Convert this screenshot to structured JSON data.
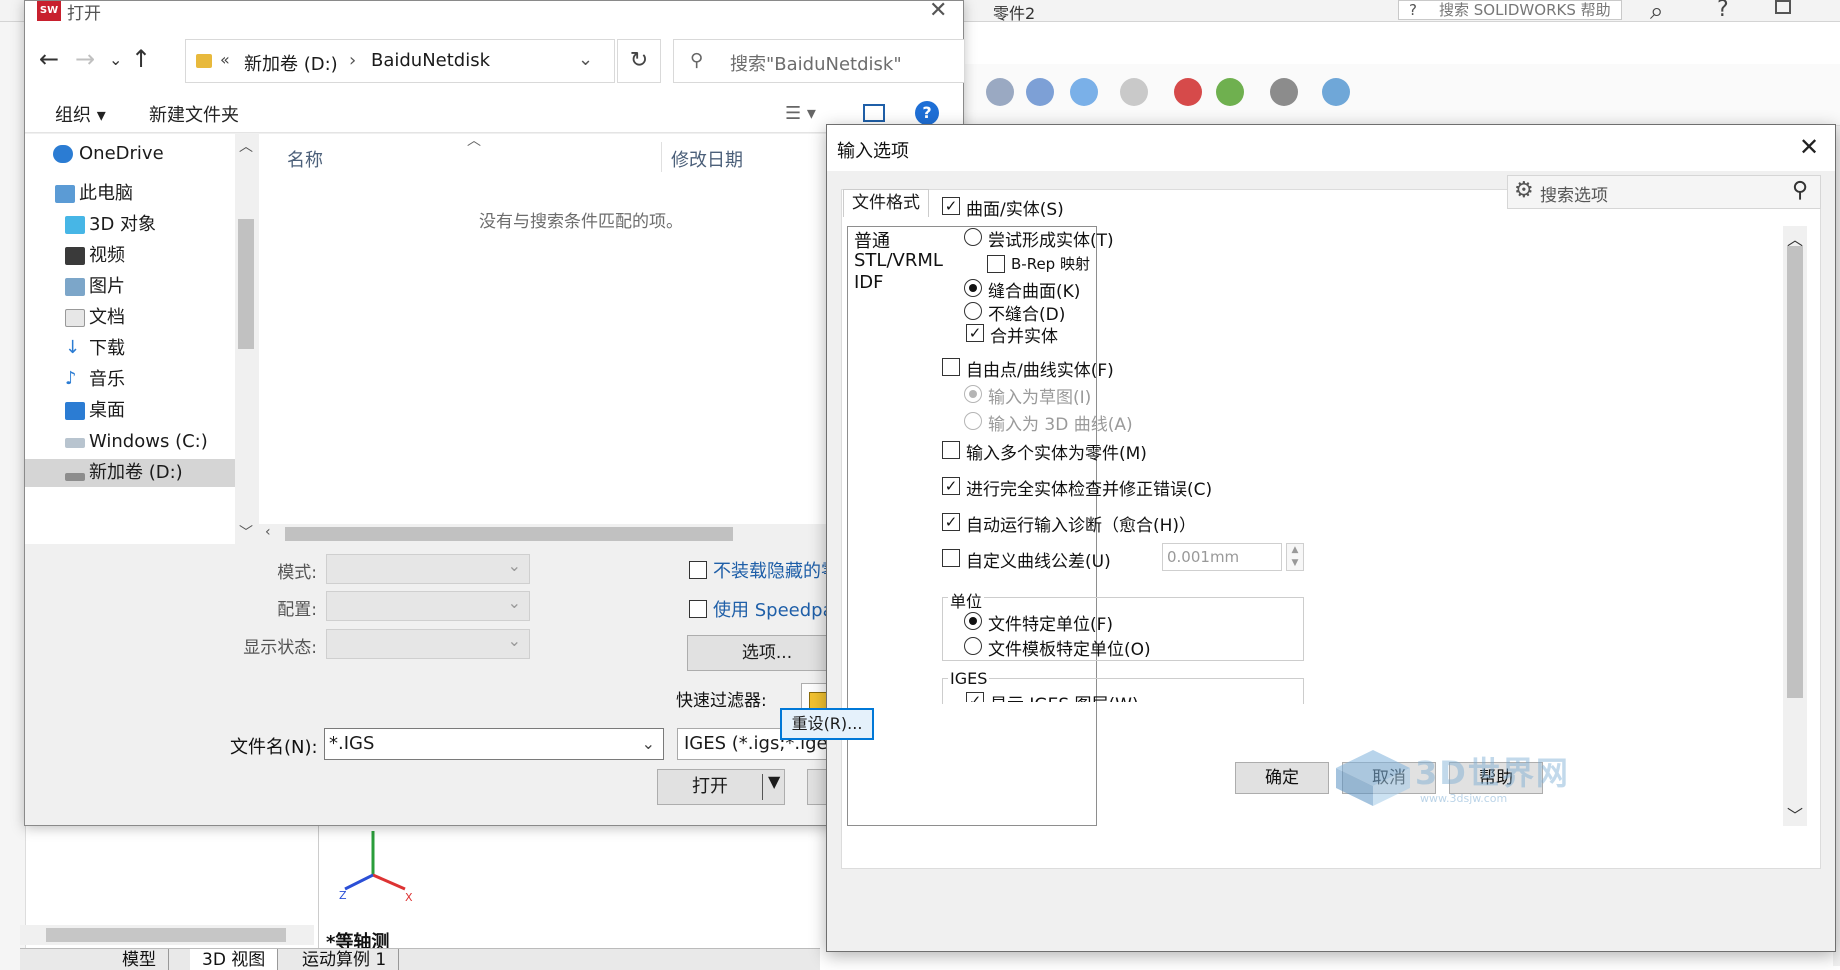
{
  "solidworks": {
    "document_title": "零件2",
    "help_search_placeholder": "搜索 SOLIDWORKS 帮助",
    "view_label": "*等轴测",
    "tabs": [
      "模型",
      "3D 视图",
      "运动算例 1"
    ]
  },
  "open_dialog": {
    "title": "打开",
    "app_icon_text": "SW",
    "address": {
      "chevrons": "«",
      "path": [
        "新加卷 (D:)",
        "BaiduNetdisk"
      ],
      "separator": "›"
    },
    "search_placeholder": "搜索\"BaiduNetdisk\"",
    "commands": {
      "organize": "组织 ▾",
      "new_folder": "新建文件夹"
    },
    "nav_items": [
      {
        "label": "OneDrive",
        "icon": "cloud-icon"
      },
      {
        "label": "此电脑",
        "icon": "computer-icon"
      },
      {
        "label": "3D 对象",
        "icon": "3d-objects-icon"
      },
      {
        "label": "视频",
        "icon": "video-icon"
      },
      {
        "label": "图片",
        "icon": "pictures-icon"
      },
      {
        "label": "文档",
        "icon": "documents-icon"
      },
      {
        "label": "下载",
        "icon": "download-icon"
      },
      {
        "label": "音乐",
        "icon": "music-icon"
      },
      {
        "label": "桌面",
        "icon": "desktop-icon"
      },
      {
        "label": "Windows (C:)",
        "icon": "drive-c-icon"
      },
      {
        "label": "新加卷 (D:)",
        "icon": "drive-d-icon"
      }
    ],
    "columns": {
      "name": "名称",
      "modified": "修改日期"
    },
    "empty_message": "没有与搜索条件匹配的项。",
    "form": {
      "mode_label": "模式:",
      "config_label": "配置:",
      "display_state_label": "显示状态:",
      "hide_components_label": "不装载隐藏的零部件",
      "speedpak_label": "使用 Speedpak(U)",
      "options_button": "选项...",
      "quick_filter_label": "快速过滤器:",
      "filename_label": "文件名(N):",
      "filename_value": "*.IGS",
      "filter_value": "IGES (*.igs;*.iges)",
      "open_button": "打开"
    }
  },
  "import_dialog": {
    "title": "输入选项",
    "tab_label": "文件格式",
    "search_placeholder": "搜索选项",
    "formats": [
      "普通",
      "STL/VRML",
      "IDF"
    ],
    "options": {
      "surfaces_solids": "曲面/实体(S)",
      "try_form_solid": "尝试形成实体(T)",
      "brep_mapping": "B-Rep 映射",
      "knit_surfaces": "缝合曲面(K)",
      "no_knit": "不缝合(D)",
      "merge_entities": "合并实体",
      "free_point_curve": "自由点/曲线实体(F)",
      "import_as_sketch": "输入为草图(I)",
      "import_as_3d_curve": "输入为 3D 曲线(A)",
      "import_multiple_bodies": "输入多个实体为零件(M)",
      "full_entity_check": "进行完全实体检查并修正错误(C)",
      "auto_import_diagnostics": "自动运行输入诊断（愈合(H)）",
      "custom_curve_tolerance": "自定义曲线公差(U)",
      "tolerance_value": "0.001mm"
    },
    "units_group": {
      "title": "单位",
      "file_units": "文件特定单位(F)",
      "template_units": "文件模板特定单位(O)"
    },
    "iges_group": {
      "title": "IGES",
      "show_layers": "显示 IGES 图层(W)"
    },
    "buttons": {
      "reset": "重设(R)...",
      "ok": "确定",
      "cancel": "取消",
      "help": "帮助"
    }
  },
  "watermark": {
    "text": "3D世界网",
    "url": "www.3dsjw.com"
  },
  "colors": {
    "accent_blue": "#0078d7",
    "link_blue": "#1f5fa8",
    "sw_red": "#c8202e"
  }
}
